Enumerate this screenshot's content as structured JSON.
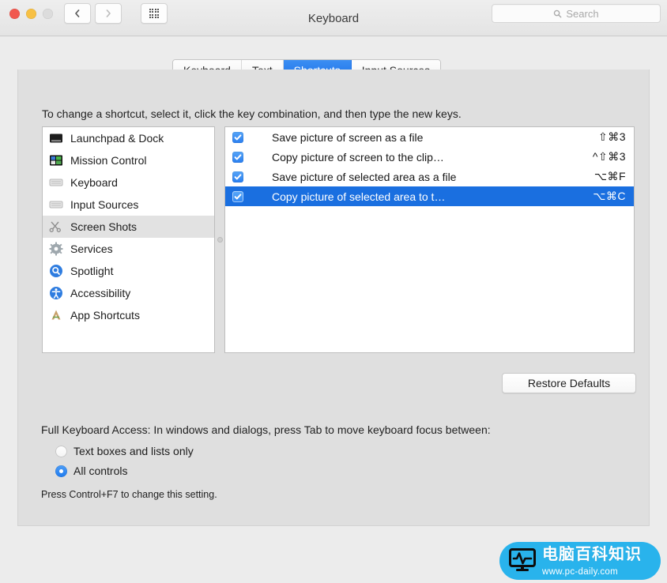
{
  "window": {
    "title": "Keyboard",
    "traffic_lights": [
      "close-red",
      "minimize-yellow",
      "zoom-gray-disabled"
    ],
    "nav_back": "back-chevron",
    "nav_forward": "forward-chevron",
    "show_all": "grid-icon"
  },
  "search": {
    "placeholder": "Search",
    "value": ""
  },
  "tabs": [
    {
      "label": "Keyboard",
      "active": false
    },
    {
      "label": "Text",
      "active": false
    },
    {
      "label": "Shortcuts",
      "active": true
    },
    {
      "label": "Input Sources",
      "active": false
    }
  ],
  "main": {
    "instructions": "To change a shortcut, select it, click the key combination, and then type the new keys.",
    "restore_label": "Restore Defaults"
  },
  "sidebar": {
    "items": [
      {
        "label": "Launchpad & Dock",
        "icon": "launchpad-dock-icon",
        "selected": false
      },
      {
        "label": "Mission Control",
        "icon": "mission-control-icon",
        "selected": false
      },
      {
        "label": "Keyboard",
        "icon": "keyboard-icon",
        "selected": false
      },
      {
        "label": "Input Sources",
        "icon": "input-sources-icon",
        "selected": false
      },
      {
        "label": "Screen Shots",
        "icon": "screen-shots-icon",
        "selected": true
      },
      {
        "label": "Services",
        "icon": "services-gear-icon",
        "selected": false
      },
      {
        "label": "Spotlight",
        "icon": "spotlight-magnifier-icon",
        "selected": false
      },
      {
        "label": "Accessibility",
        "icon": "accessibility-icon",
        "selected": false
      },
      {
        "label": "App Shortcuts",
        "icon": "app-shortcuts-icon",
        "selected": false
      }
    ]
  },
  "shortcuts": {
    "rows": [
      {
        "label": "Save picture of screen as a file",
        "keys": "⇧⌘3",
        "checked": true,
        "selected": false
      },
      {
        "label": "Copy picture of screen to the clip…",
        "keys": "^⇧⌘3",
        "checked": true,
        "selected": false
      },
      {
        "label": "Save picture of selected area as a file",
        "keys": "⌥⌘F",
        "checked": true,
        "selected": false
      },
      {
        "label": "Copy picture of selected area to t…",
        "keys": "⌥⌘C",
        "checked": true,
        "selected": true
      }
    ]
  },
  "full_keyboard_access": {
    "label": "Full Keyboard Access: In windows and dialogs, press Tab to move keyboard focus between:",
    "options": [
      {
        "label": "Text boxes and lists only",
        "selected": false
      },
      {
        "label": "All controls",
        "selected": true
      }
    ],
    "hint": "Press Control+F7 to change this setting."
  },
  "watermark": {
    "name_cn": "电脑百科知识",
    "url": "www.pc-daily.com",
    "icon": "monitor-pulse-icon"
  },
  "colors": {
    "accent_blue": "#1a6fe0",
    "tab_blue": "#1c72e8",
    "checkbox_blue": "#2a7ff0",
    "window_bg": "#ececec",
    "panel_bg": "#dfdfdf",
    "watermark_blue": "#29b3ec"
  }
}
